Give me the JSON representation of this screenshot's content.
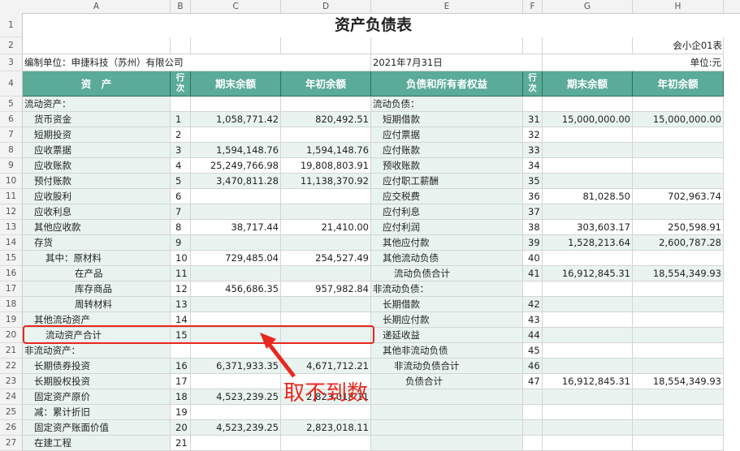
{
  "columns": [
    "A",
    "B",
    "C",
    "D",
    "E",
    "F",
    "G",
    "H"
  ],
  "sheet": {
    "title": "资产负债表",
    "form_code": "会小企01表",
    "unit_label": "编制单位：申捷科技（苏州）有限公司",
    "date": "2021年7月31日",
    "currency_unit": "单位:元",
    "headers": {
      "asset": "资　产",
      "line_no": "行次",
      "end_balance": "期末余额",
      "begin_balance": "年初余额",
      "liab": "负债和所有者权益",
      "line_no2": "行次",
      "end_balance2": "期末余额",
      "begin_balance2": "年初余额"
    },
    "rows": [
      {
        "r": "5",
        "a": "流动资产：",
        "b": "",
        "c": "",
        "d": "",
        "e": "流动负债：",
        "f": "",
        "g": "",
        "h": ""
      },
      {
        "r": "6",
        "a": "货币资金",
        "b": "1",
        "c": "1,058,771.42",
        "d": "820,492.51",
        "e": "短期借款",
        "f": "31",
        "g": "15,000,000.00",
        "h": "15,000,000.00"
      },
      {
        "r": "7",
        "a": "短期投资",
        "b": "2",
        "c": "",
        "d": "",
        "e": "应付票据",
        "f": "32",
        "g": "",
        "h": ""
      },
      {
        "r": "8",
        "a": "应收票据",
        "b": "3",
        "c": "1,594,148.76",
        "d": "1,594,148.76",
        "e": "应付账款",
        "f": "33",
        "g": "",
        "h": ""
      },
      {
        "r": "9",
        "a": "应收账款",
        "b": "4",
        "c": "25,249,766.98",
        "d": "19,808,803.91",
        "e": "预收账款",
        "f": "34",
        "g": "",
        "h": ""
      },
      {
        "r": "10",
        "a": "预付账款",
        "b": "5",
        "c": "3,470,811.28",
        "d": "11,138,370.92",
        "e": "应付职工薪酬",
        "f": "35",
        "g": "",
        "h": ""
      },
      {
        "r": "11",
        "a": "应收股利",
        "b": "6",
        "c": "",
        "d": "",
        "e": "应交税费",
        "f": "36",
        "g": "81,028.50",
        "h": "702,963.74"
      },
      {
        "r": "12",
        "a": "应收利息",
        "b": "7",
        "c": "",
        "d": "",
        "e": "应付利息",
        "f": "37",
        "g": "",
        "h": ""
      },
      {
        "r": "13",
        "a": "其他应收款",
        "b": "8",
        "c": "38,717.44",
        "d": "21,410.00",
        "e": "应付利润",
        "f": "38",
        "g": "303,603.17",
        "h": "250,598.91"
      },
      {
        "r": "14",
        "a": "存货",
        "b": "9",
        "c": "",
        "d": "",
        "e": "其他应付款",
        "f": "39",
        "g": "1,528,213.64",
        "h": "2,600,787.28"
      },
      {
        "r": "15",
        "a": "其中：原材料",
        "b": "10",
        "c": "729,485.04",
        "d": "254,527.49",
        "e": "其他流动负债",
        "f": "40",
        "g": "",
        "h": ""
      },
      {
        "r": "16",
        "a": "在产品",
        "b": "11",
        "c": "",
        "d": "",
        "e": "流动负债合计",
        "f": "41",
        "g": "16,912,845.31",
        "h": "18,554,349.93"
      },
      {
        "r": "17",
        "a": "库存商品",
        "b": "12",
        "c": "456,686.35",
        "d": "957,982.84",
        "e": "非流动负债：",
        "f": "",
        "g": "",
        "h": ""
      },
      {
        "r": "18",
        "a": "周转材料",
        "b": "13",
        "c": "",
        "d": "",
        "e": "长期借款",
        "f": "42",
        "g": "",
        "h": ""
      },
      {
        "r": "19",
        "a": "其他流动资产",
        "b": "14",
        "c": "",
        "d": "",
        "e": "长期应付款",
        "f": "43",
        "g": "",
        "h": ""
      },
      {
        "r": "20",
        "a": "流动资产合计",
        "b": "15",
        "c": "",
        "d": "",
        "e": "递延收益",
        "f": "44",
        "g": "",
        "h": ""
      },
      {
        "r": "21",
        "a": "非流动资产：",
        "b": "",
        "c": "",
        "d": "",
        "e": "其他非流动负债",
        "f": "45",
        "g": "",
        "h": ""
      },
      {
        "r": "22",
        "a": "长期债券投资",
        "b": "16",
        "c": "6,371,933.35",
        "d": "4,671,712.21",
        "e": "非流动负债合计",
        "f": "46",
        "g": "",
        "h": ""
      },
      {
        "r": "23",
        "a": "长期股权投资",
        "b": "17",
        "c": "",
        "d": "",
        "e": "负债合计",
        "f": "47",
        "g": "16,912,845.31",
        "h": "18,554,349.93"
      },
      {
        "r": "24",
        "a": "固定资产原价",
        "b": "18",
        "c": "4,523,239.25",
        "d": "2,823,018.11",
        "e": "",
        "f": "",
        "g": "",
        "h": ""
      },
      {
        "r": "25",
        "a": "减：累计折旧",
        "b": "19",
        "c": "",
        "d": "",
        "e": "",
        "f": "",
        "g": "",
        "h": ""
      },
      {
        "r": "26",
        "a": "固定资产账面价值",
        "b": "20",
        "c": "4,523,239.25",
        "d": "2,823,018.11",
        "e": "",
        "f": "",
        "g": "",
        "h": ""
      },
      {
        "r": "27",
        "a": "在建工程",
        "b": "21",
        "c": "",
        "d": "",
        "e": "",
        "f": "",
        "g": "",
        "h": ""
      }
    ]
  },
  "annotation": {
    "text": "取不到数",
    "color": "#e8281e"
  },
  "colors": {
    "header_fill": "#5aab98",
    "shade_fill": "#e9f4f1"
  }
}
